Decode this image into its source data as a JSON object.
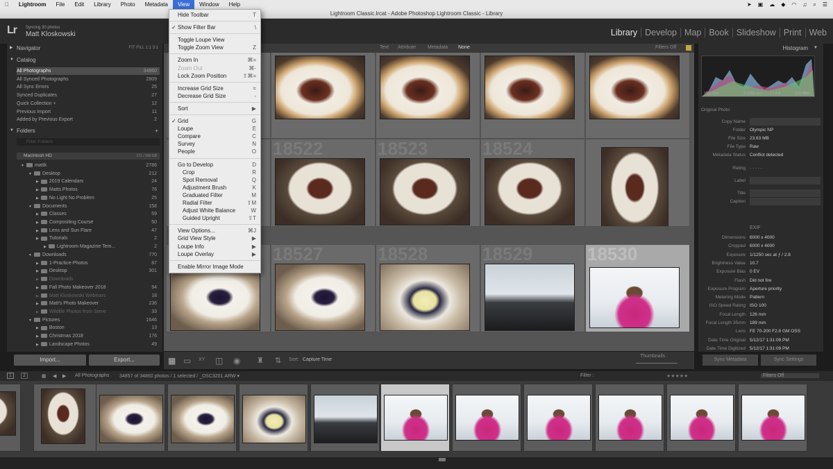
{
  "menubar": {
    "app": "Lightroom",
    "items": [
      "File",
      "Edit",
      "Library",
      "Photo",
      "Metadata",
      "View",
      "Window",
      "Help"
    ]
  },
  "window_title": "Lightroom Classic.lrcat - Adobe Photoshop Lightroom Classic - Library",
  "identity": {
    "logo": "Lr",
    "sync": "Syncing 30 photos",
    "user": "Matt Kloskowski"
  },
  "modules": [
    "Library",
    "Develop",
    "Map",
    "Book",
    "Slideshow",
    "Print",
    "Web"
  ],
  "left": {
    "navigator": "Navigator",
    "nav_zoom": "FIT  FILL  1:1  3:1",
    "catalog": "Catalog",
    "catalog_rows": [
      {
        "l": "All Photographs",
        "c": "34860"
      },
      {
        "l": "All Synced Photographs",
        "c": "2809"
      },
      {
        "l": "All Sync Errors",
        "c": "25"
      },
      {
        "l": "Synced Duplicates",
        "c": "27"
      },
      {
        "l": "Quick Collection +",
        "c": "12"
      },
      {
        "l": "Previous Import",
        "c": "11"
      },
      {
        "l": "Added by Previous Export",
        "c": "2"
      }
    ],
    "folders": "Folders",
    "folder_filter": "Filter Folders",
    "volume": "Macintosh HD",
    "volume_size": "171 / 999 GB",
    "folder_rows": [
      {
        "l": "mattk",
        "c": "2786"
      },
      {
        "l": "Desktop",
        "c": "212"
      },
      {
        "l": "2019 Calendars",
        "c": "24"
      },
      {
        "l": "Matts Photos",
        "c": "76"
      },
      {
        "l": "No Light No Problem",
        "c": "25"
      },
      {
        "l": "Documents",
        "c": "158"
      },
      {
        "l": "Classes",
        "c": "59"
      },
      {
        "l": "Compositing Course",
        "c": "50"
      },
      {
        "l": "Lens and Sun Flare",
        "c": "47"
      },
      {
        "l": "Tutorials",
        "c": "2"
      },
      {
        "l": "Lightroom Magazine Tem...",
        "c": "2"
      },
      {
        "l": "Downloads",
        "c": "770"
      },
      {
        "l": "1-Practice-Photos",
        "c": "87"
      },
      {
        "l": "Desktop",
        "c": "301"
      },
      {
        "l": "Downloads",
        "c": ""
      },
      {
        "l": "Fall Photo Makeover 2018",
        "c": "94"
      },
      {
        "l": "Matt Kloskowski Webinars",
        "c": "18"
      },
      {
        "l": "Matt's Photo Makeover",
        "c": "236"
      },
      {
        "l": "Wildlife Photos from Steve",
        "c": "33"
      },
      {
        "l": "Pictures",
        "c": "1646"
      },
      {
        "l": "Boston",
        "c": "13"
      },
      {
        "l": "Christmas 2018",
        "c": "176"
      },
      {
        "l": "Landscape Photos",
        "c": "49"
      }
    ],
    "import": "Import...",
    "export": "Export..."
  },
  "filterbar": {
    "text": "Text",
    "attribute": "Attribute",
    "metadata": "Metadata",
    "none": "None",
    "filters_off": "Filters Off"
  },
  "grid": {
    "numbers": [
      "18522",
      "18523",
      "18524",
      "",
      "18527",
      "18528",
      "18529",
      "18530"
    ]
  },
  "toolbar": {
    "sort_label": "Sort:",
    "sort_value": "Capture Time",
    "thumbs": "Thumbnails"
  },
  "right": {
    "histogram": "Histogram",
    "histo_info": [
      "ISO 100",
      "1/1250 sec",
      "ƒ / 2.8",
      "126 MM"
    ],
    "original": "Original Photo",
    "meta": [
      {
        "k": "Copy Name",
        "v": ""
      },
      {
        "k": "Folder",
        "v": "Olympic NP"
      },
      {
        "k": "File Size",
        "v": "23.63 MB"
      },
      {
        "k": "File Type",
        "v": "Raw"
      },
      {
        "k": "Metadata Status",
        "v": "Conflict detected"
      },
      {
        "k": "Rating",
        "v": "· · · · ·"
      },
      {
        "k": "Label",
        "v": ""
      },
      {
        "k": "Title",
        "v": ""
      },
      {
        "k": "Caption",
        "v": ""
      }
    ],
    "exif": "EXIF",
    "exif_rows": [
      {
        "k": "Dimensions",
        "v": "6000 x 4000"
      },
      {
        "k": "Cropped",
        "v": "6000 x 4000"
      },
      {
        "k": "Exposure",
        "v": "1/1250 sec at ƒ / 2.8"
      },
      {
        "k": "Brightness Value",
        "v": "10.7"
      },
      {
        "k": "Exposure Bias",
        "v": "0 EV"
      },
      {
        "k": "Flash",
        "v": "Did not fire"
      },
      {
        "k": "Exposure Program",
        "v": "Aperture priority"
      },
      {
        "k": "Metering Mode",
        "v": "Pattern"
      },
      {
        "k": "ISO Speed Rating",
        "v": "ISO 100"
      },
      {
        "k": "Focal Length",
        "v": "126 mm"
      },
      {
        "k": "Focal Length 35mm",
        "v": "189 mm"
      },
      {
        "k": "Lens",
        "v": "FE 70-200 F2.8 GM OSS"
      },
      {
        "k": "Date Time Original",
        "v": "5/12/17 1:31:09 PM"
      },
      {
        "k": "Date Time Digitized",
        "v": "5/12/17 1:31:09 PM"
      }
    ],
    "sync_meta": "Sync Metadata",
    "sync_settings": "Sync Settings"
  },
  "filmstrip": {
    "source": "All Photographs",
    "count": "34857 of 34860 photos / 1 selected / _DSC3201.ARW ▾",
    "filter": "Filter :",
    "filters_off": "Filters Off"
  },
  "menu": [
    {
      "t": "item",
      "l": "Hide Toolbar",
      "s": "T"
    },
    {
      "t": "sep"
    },
    {
      "t": "item",
      "l": "Show Filter Bar",
      "s": "\\",
      "chk": "✓"
    },
    {
      "t": "sep"
    },
    {
      "t": "item",
      "l": "Toggle Loupe View",
      "s": ""
    },
    {
      "t": "item",
      "l": "Toggle Zoom View",
      "s": "Z"
    },
    {
      "t": "sep"
    },
    {
      "t": "item",
      "l": "Zoom In",
      "s": "⌘="
    },
    {
      "t": "item",
      "l": "Zoom Out",
      "s": "⌘-",
      "dis": true
    },
    {
      "t": "item",
      "l": "Lock Zoom Position",
      "s": "⇧⌘="
    },
    {
      "t": "sep"
    },
    {
      "t": "item",
      "l": "Increase Grid Size",
      "s": "="
    },
    {
      "t": "item",
      "l": "Decrease Grid Size",
      "s": "-"
    },
    {
      "t": "sep"
    },
    {
      "t": "item",
      "l": "Sort",
      "s": "▶"
    },
    {
      "t": "sep"
    },
    {
      "t": "item",
      "l": "Grid",
      "s": "G",
      "chk": "✓"
    },
    {
      "t": "item",
      "l": "Loupe",
      "s": "E"
    },
    {
      "t": "item",
      "l": "Compare",
      "s": "C"
    },
    {
      "t": "item",
      "l": "Survey",
      "s": "N"
    },
    {
      "t": "item",
      "l": "People",
      "s": "O"
    },
    {
      "t": "sep"
    },
    {
      "t": "item",
      "l": "Go to Develop",
      "s": "D"
    },
    {
      "t": "item",
      "l": "Crop",
      "s": "R",
      "sub": true
    },
    {
      "t": "item",
      "l": "Spot Removal",
      "s": "Q",
      "sub": true
    },
    {
      "t": "item",
      "l": "Adjustment Brush",
      "s": "K",
      "sub": true
    },
    {
      "t": "item",
      "l": "Graduated Filter",
      "s": "M",
      "sub": true
    },
    {
      "t": "item",
      "l": "Radial Filter",
      "s": "⇧M",
      "sub": true
    },
    {
      "t": "item",
      "l": "Adjust White Balance",
      "s": "W",
      "sub": true
    },
    {
      "t": "item",
      "l": "Guided Upright",
      "s": "⇧T",
      "sub": true
    },
    {
      "t": "sep"
    },
    {
      "t": "item",
      "l": "View Options...",
      "s": "⌘J"
    },
    {
      "t": "item",
      "l": "Grid View Style",
      "s": "▶"
    },
    {
      "t": "item",
      "l": "Loupe Info",
      "s": "▶"
    },
    {
      "t": "item",
      "l": "Loupe Overlay",
      "s": "▶"
    },
    {
      "t": "sep"
    },
    {
      "t": "item",
      "l": "Enable Mirror Image Mode",
      "s": ""
    }
  ],
  "colors": {
    "accent": "#3a6fd8",
    "panel": "#2b2b2b",
    "grid": "#555555",
    "magenta": "#d0308a"
  }
}
